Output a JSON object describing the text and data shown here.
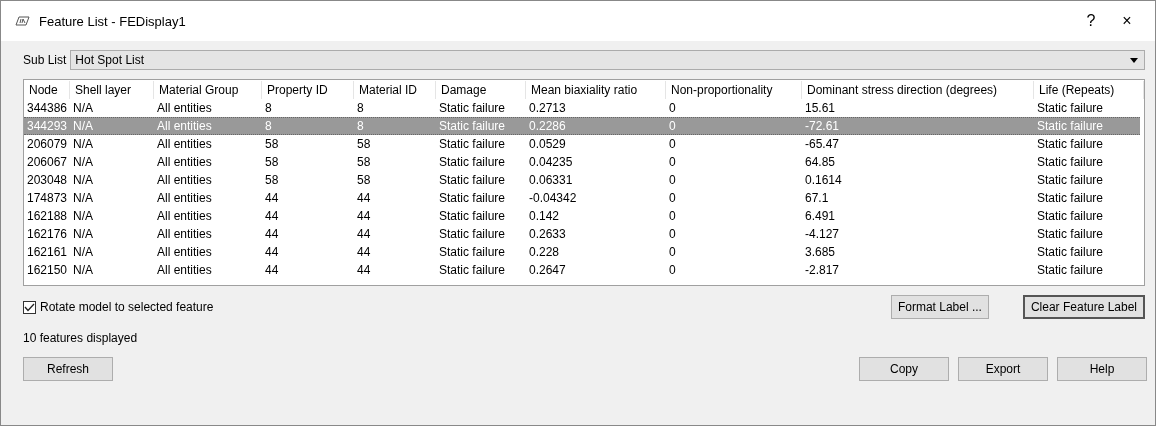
{
  "window": {
    "title": "Feature List - FEDisplay1",
    "buttons": [
      "?",
      "×"
    ]
  },
  "sub_list": {
    "label": "Sub List",
    "value": "Hot Spot List"
  },
  "table": {
    "columns": [
      "Node",
      "Shell layer",
      "Material Group",
      "Property ID",
      "Material ID",
      "Damage",
      "Mean biaxiality ratio",
      "Non-proportionality",
      "Dominant stress direction (degrees)",
      "Life (Repeats)"
    ],
    "rows": [
      {
        "cells": [
          "344386",
          "N/A",
          "All entities",
          "8",
          "8",
          "Static failure",
          "0.2713",
          "0",
          "15.61",
          "Static failure"
        ],
        "selected": false
      },
      {
        "cells": [
          "344293",
          "N/A",
          "All entities",
          "8",
          "8",
          "Static failure",
          "0.2286",
          "0",
          "-72.61",
          "Static failure"
        ],
        "selected": true
      },
      {
        "cells": [
          "206079",
          "N/A",
          "All entities",
          "58",
          "58",
          "Static failure",
          "0.0529",
          "0",
          "-65.47",
          "Static failure"
        ],
        "selected": false
      },
      {
        "cells": [
          "206067",
          "N/A",
          "All entities",
          "58",
          "58",
          "Static failure",
          "0.04235",
          "0",
          "64.85",
          "Static failure"
        ],
        "selected": false
      },
      {
        "cells": [
          "203048",
          "N/A",
          "All entities",
          "58",
          "58",
          "Static failure",
          "0.06331",
          "0",
          "0.1614",
          "Static failure"
        ],
        "selected": false
      },
      {
        "cells": [
          "174873",
          "N/A",
          "All entities",
          "44",
          "44",
          "Static failure",
          "-0.04342",
          "0",
          "67.1",
          "Static failure"
        ],
        "selected": false
      },
      {
        "cells": [
          "162188",
          "N/A",
          "All entities",
          "44",
          "44",
          "Static failure",
          "0.142",
          "0",
          "6.491",
          "Static failure"
        ],
        "selected": false
      },
      {
        "cells": [
          "162176",
          "N/A",
          "All entities",
          "44",
          "44",
          "Static failure",
          "0.2633",
          "0",
          "-4.127",
          "Static failure"
        ],
        "selected": false
      },
      {
        "cells": [
          "162161",
          "N/A",
          "All entities",
          "44",
          "44",
          "Static failure",
          "0.228",
          "0",
          "3.685",
          "Static failure"
        ],
        "selected": false
      },
      {
        "cells": [
          "162150",
          "N/A",
          "All entities",
          "44",
          "44",
          "Static failure",
          "0.2647",
          "0",
          "-2.817",
          "Static failure"
        ],
        "selected": false
      }
    ]
  },
  "rotate_checkbox": {
    "label": "Rotate model to selected feature",
    "checked": true
  },
  "label_buttons": [
    {
      "label": "Format Label ...",
      "default": false
    },
    {
      "label": "Clear Feature Label",
      "default": true
    }
  ],
  "status": "10 features displayed",
  "refresh_button": "Refresh",
  "bottom_buttons": [
    "Copy",
    "Export",
    "Help"
  ]
}
